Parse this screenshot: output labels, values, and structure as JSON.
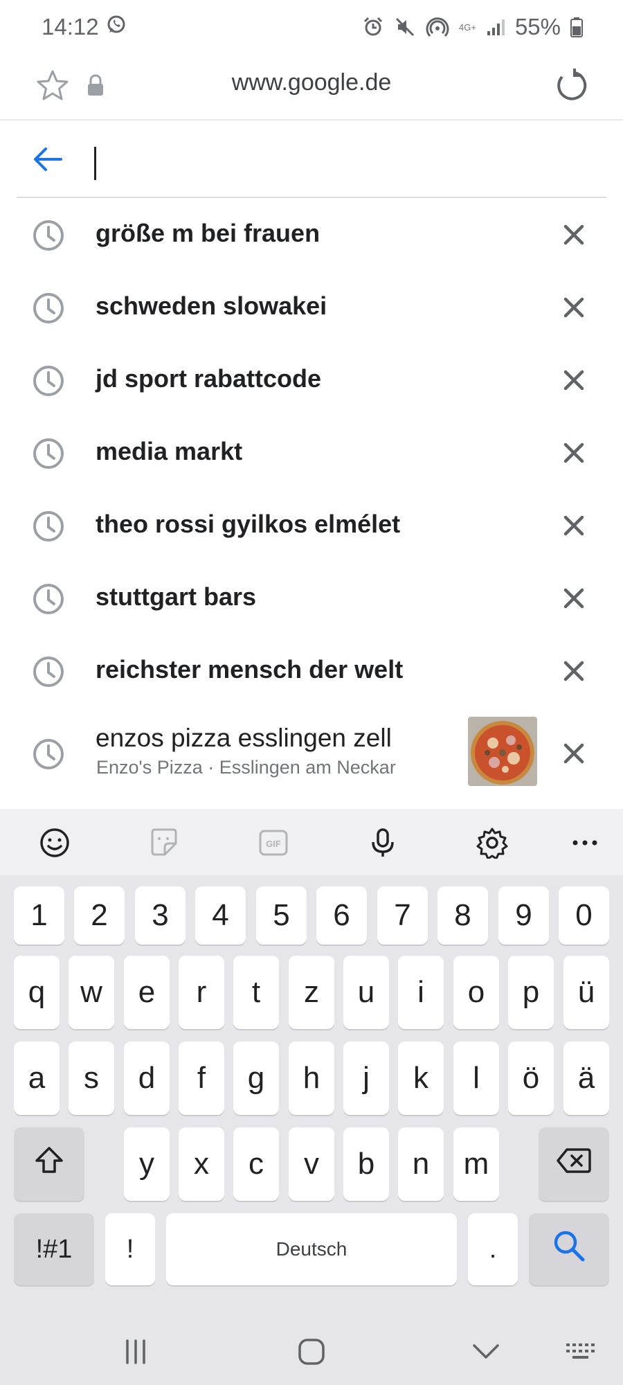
{
  "status_bar": {
    "time": "14:12",
    "network_type": "4G+",
    "battery_percent": "55%"
  },
  "browser": {
    "url": "www.google.de",
    "search_value": ""
  },
  "suggestions": [
    {
      "text": "größe m bei frauen"
    },
    {
      "text": "schweden slowakei"
    },
    {
      "text": "jd sport rabattcode"
    },
    {
      "text": "media markt"
    },
    {
      "text": "theo rossi gyilkos elmélet"
    },
    {
      "text": "stuttgart bars"
    },
    {
      "text": "reichster mensch der welt"
    },
    {
      "text": "enzos pizza esslingen zell",
      "subtitle": "Enzo's Pizza · Esslingen am Neckar"
    }
  ],
  "keyboard": {
    "toolbar_icons": [
      "emoji-icon",
      "sticker-icon",
      "gif-icon",
      "microphone-icon",
      "settings-icon",
      "more-icon"
    ],
    "gif_label": "GIF",
    "number_row": [
      "1",
      "2",
      "3",
      "4",
      "5",
      "6",
      "7",
      "8",
      "9",
      "0"
    ],
    "row1": [
      "q",
      "w",
      "e",
      "r",
      "t",
      "z",
      "u",
      "i",
      "o",
      "p",
      "ü"
    ],
    "row2": [
      "a",
      "s",
      "d",
      "f",
      "g",
      "h",
      "j",
      "k",
      "l",
      "ö",
      "ä"
    ],
    "row3": [
      "y",
      "x",
      "c",
      "v",
      "b",
      "n",
      "m"
    ],
    "symbols_label": "!#1",
    "exclaim_label": "!",
    "space_label": "Deutsch",
    "period_label": "."
  },
  "colors": {
    "accent_blue": "#1a73e8",
    "icon_gray": "#5f6368",
    "keyboard_bg": "#e6e6ea"
  }
}
